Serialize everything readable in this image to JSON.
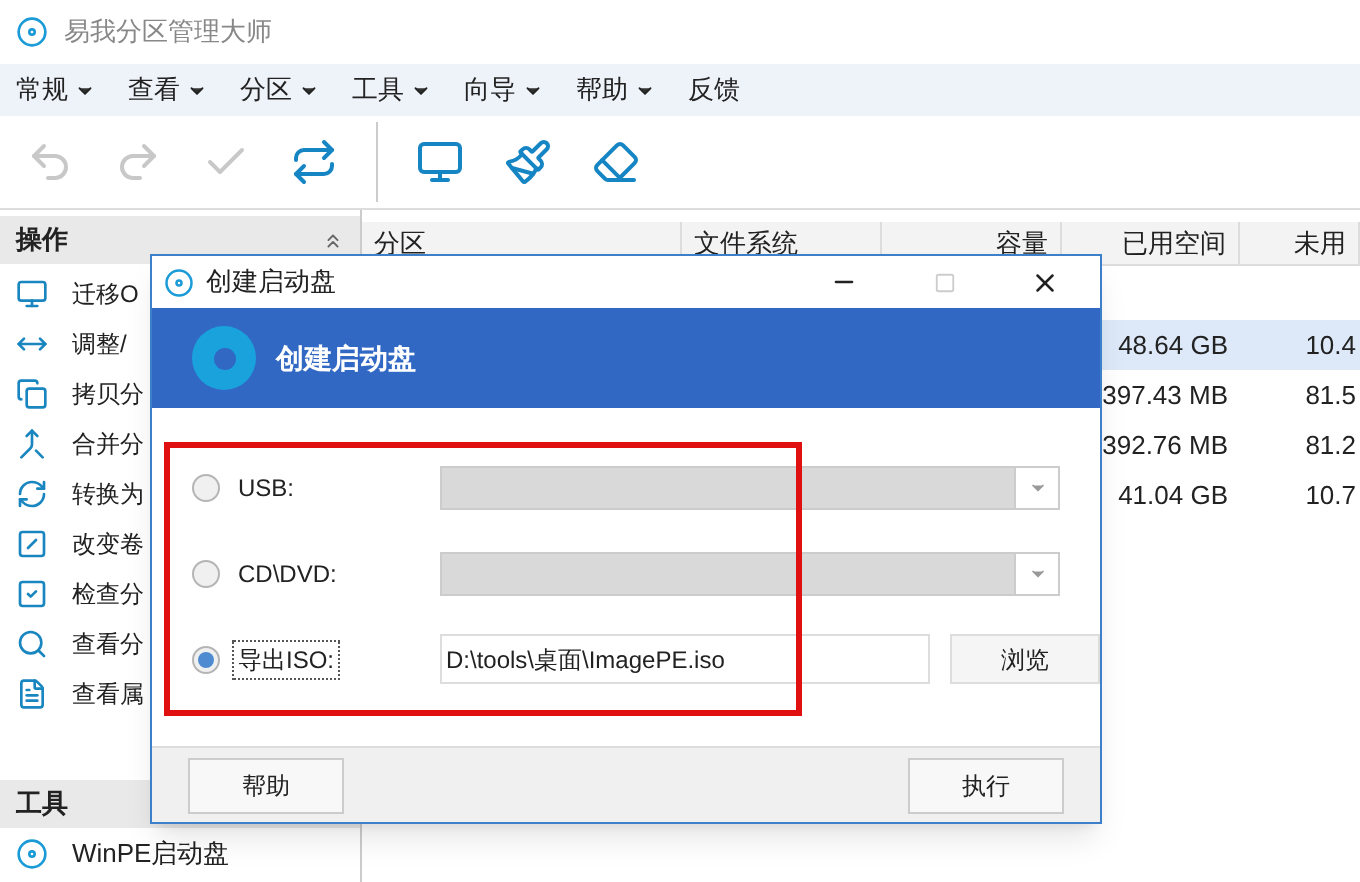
{
  "app": {
    "title": "易我分区管理大师"
  },
  "menu": [
    {
      "label": "常规",
      "dropdown": true
    },
    {
      "label": "查看",
      "dropdown": true
    },
    {
      "label": "分区",
      "dropdown": true
    },
    {
      "label": "工具",
      "dropdown": true
    },
    {
      "label": "向导",
      "dropdown": true
    },
    {
      "label": "帮助",
      "dropdown": true
    },
    {
      "label": "反馈",
      "dropdown": false
    }
  ],
  "toolbar": [
    {
      "disabled": true
    },
    {
      "disabled": true
    },
    {
      "disabled": true
    },
    {
      "disabled": false
    },
    {
      "disabled": false
    },
    {
      "disabled": false
    },
    {
      "disabled": false
    }
  ],
  "operations_panel": {
    "title": "操作",
    "items": [
      "迁移O",
      "调整/",
      "拷贝分",
      "合并分",
      "转换为",
      "改变卷",
      "检查分",
      "查看分",
      "查看属"
    ]
  },
  "tools_panel": {
    "title": "工具",
    "items": [
      "WinPE启动盘"
    ]
  },
  "table": {
    "columns": [
      "分区",
      "文件系统",
      "容量",
      "已用空间",
      "未用"
    ],
    "rows": [
      {
        "used": "48.64 GB",
        "unused": "10.4",
        "selected": true
      },
      {
        "used": "397.43 MB",
        "unused": "81.5",
        "selected": false
      },
      {
        "used": "392.76 MB",
        "unused": "81.2",
        "selected": false
      },
      {
        "used": "41.04 GB",
        "unused": "10.7",
        "selected": false
      }
    ]
  },
  "dialog": {
    "title": "创建启动盘",
    "banner_title": "创建启动盘",
    "options": [
      {
        "kind": "combo",
        "label": "USB:",
        "selected": false,
        "disabled": true
      },
      {
        "kind": "combo",
        "label": "CD\\DVD:",
        "selected": false,
        "disabled": true
      },
      {
        "kind": "file",
        "label": "导出ISO:",
        "selected": true,
        "value": "D:\\tools\\桌面\\ImagePE.iso",
        "button": "浏览"
      }
    ],
    "help_button": "帮助",
    "run_button": "执行"
  }
}
